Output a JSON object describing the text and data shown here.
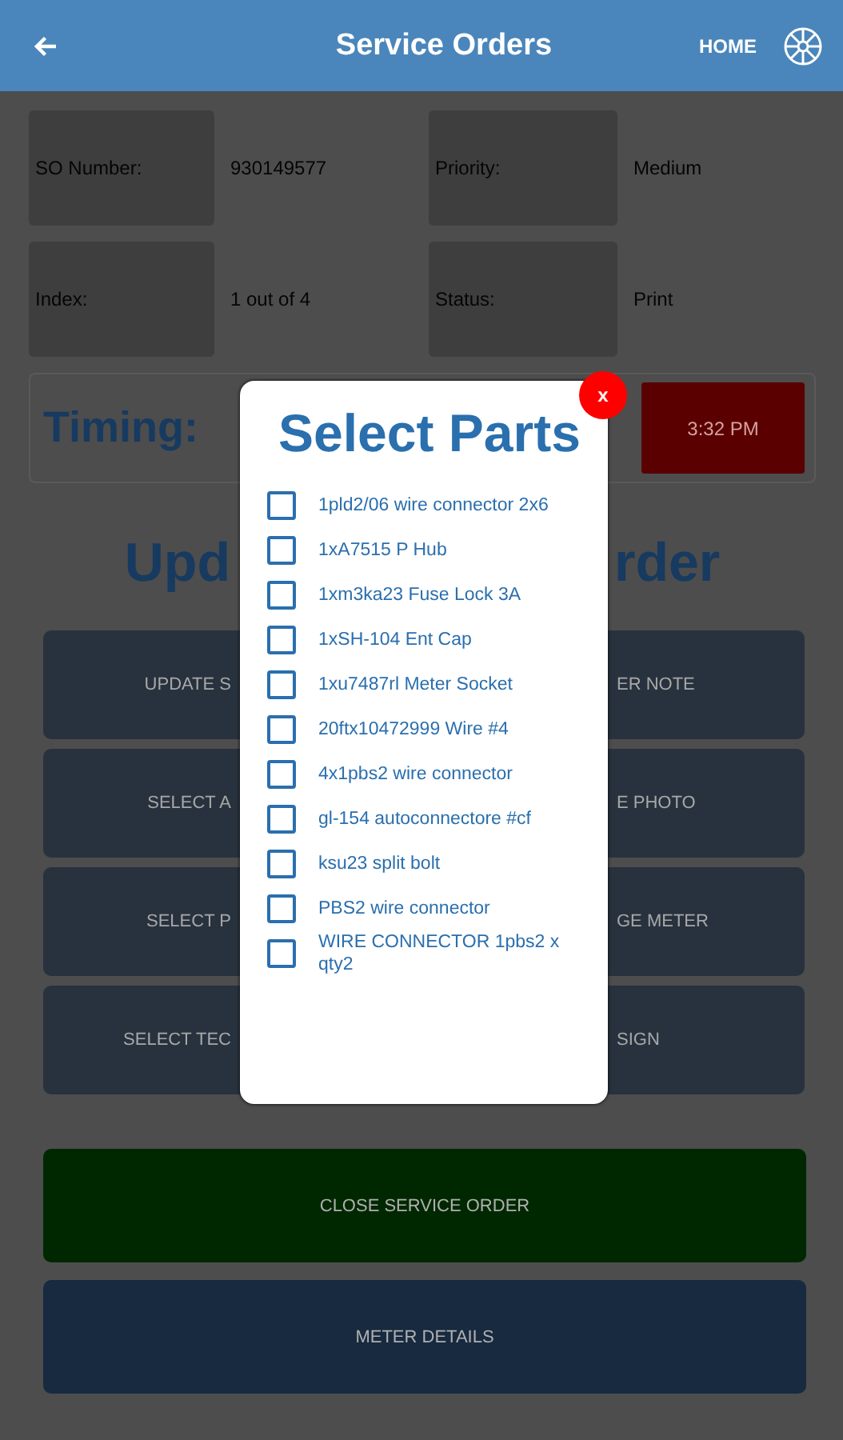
{
  "header": {
    "title": "Service Orders",
    "home": "HOME"
  },
  "info": [
    {
      "label": "SO Number:",
      "value": "930149577"
    },
    {
      "label": "Priority:",
      "value": "Medium"
    },
    {
      "label": "Index:",
      "value": "1 out of 4"
    },
    {
      "label": "Status:",
      "value": "Print"
    }
  ],
  "timing": {
    "label": "Timing:",
    "time": "3:32 PM"
  },
  "heading": {
    "left": "Upd",
    "right": "rder"
  },
  "actions": [
    {
      "left": "UPDATE S",
      "right": "ER NOTE"
    },
    {
      "left": "SELECT A",
      "right": "E PHOTO"
    },
    {
      "left": "SELECT P",
      "right": "GE METER"
    },
    {
      "left": "SELECT TEC",
      "right": "SIGN"
    }
  ],
  "close_button": "CLOSE SERVICE ORDER",
  "details_button": "METER DETAILS",
  "dialog": {
    "title": "Select Parts",
    "close": "x",
    "parts": [
      {
        "label": "1pld2/06 wire connector 2x6",
        "checked": false
      },
      {
        "label": "1xA7515 P Hub",
        "checked": false
      },
      {
        "label": "1xm3ka23 Fuse Lock 3A",
        "checked": false
      },
      {
        "label": "1xSH-104 Ent Cap",
        "checked": false
      },
      {
        "label": "1xu7487rl Meter Socket",
        "checked": false
      },
      {
        "label": "20ftx10472999 Wire #4",
        "checked": false
      },
      {
        "label": "4x1pbs2 wire connector",
        "checked": false
      },
      {
        "label": "gl-154 autoconnectore #cf",
        "checked": false
      },
      {
        "label": "ksu23 split bolt",
        "checked": false
      },
      {
        "label": "PBS2 wire connector",
        "checked": false
      },
      {
        "label": "WIRE CONNECTOR 1pbs2 x qty2",
        "checked": false
      }
    ]
  }
}
